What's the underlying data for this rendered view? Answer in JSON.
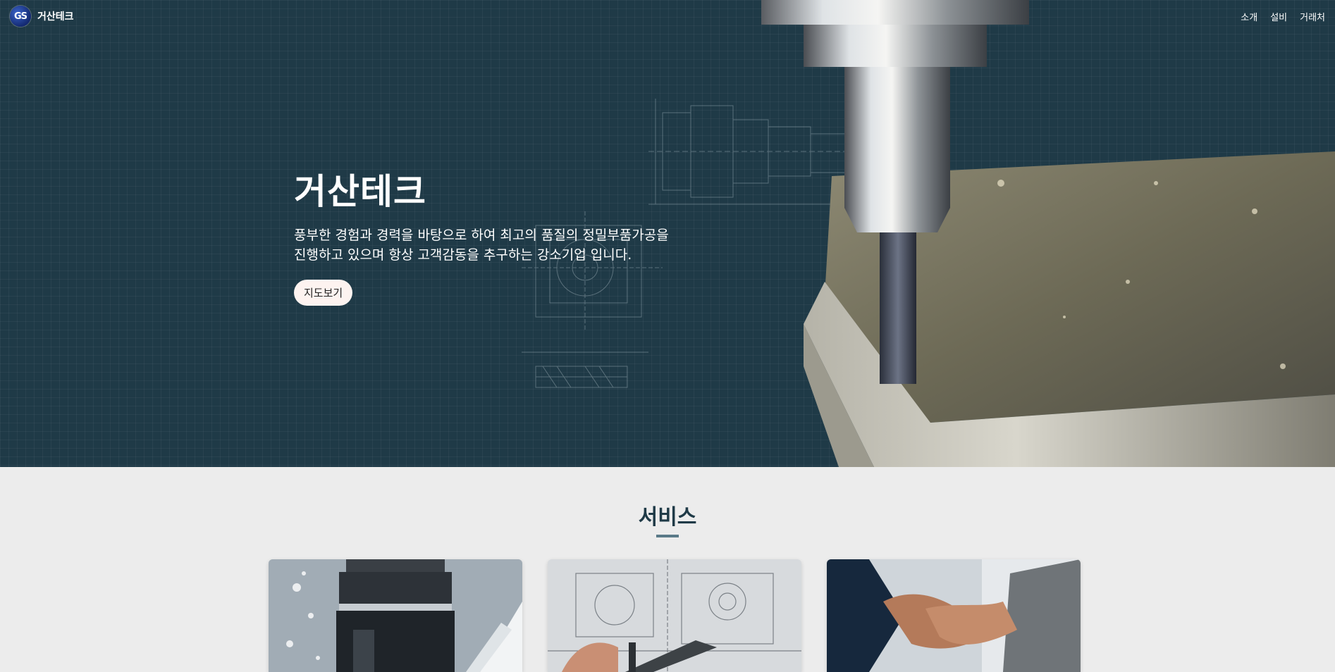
{
  "header": {
    "logo_text": "GS",
    "brand_name": "거산테크",
    "nav": [
      {
        "label": "소개"
      },
      {
        "label": "설비"
      },
      {
        "label": "거래처"
      }
    ]
  },
  "hero": {
    "title": "거산테크",
    "description_line1": "풍부한 경험과 경력을 바탕으로 하여 최고의 품질의 정밀부품가공을",
    "description_line2": "진행하고 있으며 항상 고객감동을 추구하는 강소기업 입니다.",
    "button_label": "지도보기"
  },
  "services": {
    "title": "서비스",
    "cards": [
      {
        "image": "cnc-machining-photo"
      },
      {
        "image": "blueprint-caliper-photo"
      },
      {
        "image": "handshake-photo"
      }
    ]
  },
  "colors": {
    "hero_bg": "#1f3a47",
    "section_bg": "#ececec",
    "title_color": "#1f3a47",
    "button_bg": "#fdf3f0"
  }
}
